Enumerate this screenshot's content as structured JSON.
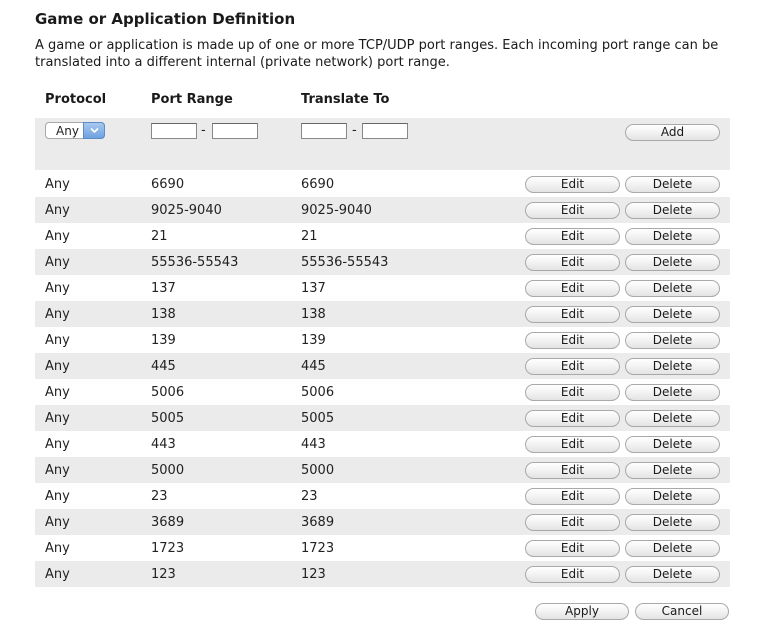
{
  "title": "Game or Application Definition",
  "description": "A game or application is made up of one or more TCP/UDP port ranges. Each incoming port range can be translated into a different internal (private network) port range.",
  "headers": {
    "protocol": "Protocol",
    "port_range": "Port Range",
    "translate_to": "Translate To"
  },
  "entry": {
    "protocol_value": "Any",
    "port_start": "",
    "port_end": "",
    "translate_start": "",
    "translate_end": "",
    "separator": "-",
    "add_label": "Add"
  },
  "rows": [
    {
      "protocol": "Any",
      "port_range": "6690",
      "translate_to": "6690"
    },
    {
      "protocol": "Any",
      "port_range": "9025-9040",
      "translate_to": "9025-9040"
    },
    {
      "protocol": "Any",
      "port_range": "21",
      "translate_to": "21"
    },
    {
      "protocol": "Any",
      "port_range": "55536-55543",
      "translate_to": "55536-55543"
    },
    {
      "protocol": "Any",
      "port_range": "137",
      "translate_to": "137"
    },
    {
      "protocol": "Any",
      "port_range": "138",
      "translate_to": "138"
    },
    {
      "protocol": "Any",
      "port_range": "139",
      "translate_to": "139"
    },
    {
      "protocol": "Any",
      "port_range": "445",
      "translate_to": "445"
    },
    {
      "protocol": "Any",
      "port_range": "5006",
      "translate_to": "5006"
    },
    {
      "protocol": "Any",
      "port_range": "5005",
      "translate_to": "5005"
    },
    {
      "protocol": "Any",
      "port_range": "443",
      "translate_to": "443"
    },
    {
      "protocol": "Any",
      "port_range": "5000",
      "translate_to": "5000"
    },
    {
      "protocol": "Any",
      "port_range": "23",
      "translate_to": "23"
    },
    {
      "protocol": "Any",
      "port_range": "3689",
      "translate_to": "3689"
    },
    {
      "protocol": "Any",
      "port_range": "1723",
      "translate_to": "1723"
    },
    {
      "protocol": "Any",
      "port_range": "123",
      "translate_to": "123"
    }
  ],
  "row_actions": {
    "edit_label": "Edit",
    "delete_label": "Delete"
  },
  "footer": {
    "apply_label": "Apply",
    "cancel_label": "Cancel"
  },
  "colors": {
    "row_alt": "#ebebeb",
    "select_accent": "#6ea2e0"
  },
  "icons": {
    "select_arrow": "chevron-down-icon"
  }
}
